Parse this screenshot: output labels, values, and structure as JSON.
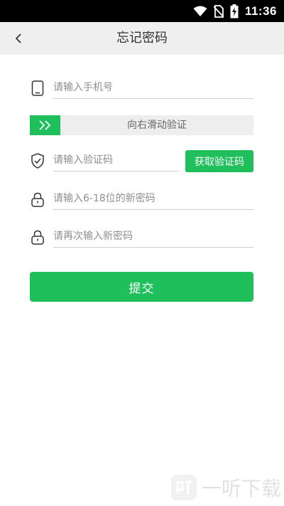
{
  "status_bar": {
    "time": "11:36",
    "icons": [
      "wifi-icon",
      "no-sim-icon",
      "battery-charging-icon"
    ]
  },
  "header": {
    "title": "忘记密码",
    "back_icon": "chevron-left-icon"
  },
  "form": {
    "phone": {
      "placeholder": "请输入手机号",
      "icon": "phone-icon"
    },
    "slider": {
      "label": "向右滑动验证",
      "handle_icon": "double-chevron-right-icon"
    },
    "code": {
      "placeholder": "请输入验证码",
      "icon": "shield-check-icon",
      "button_label": "获取验证码"
    },
    "new_password": {
      "placeholder": "请输入6-18位的新密码",
      "icon": "lock-icon"
    },
    "confirm_password": {
      "placeholder": "请再次输入新密码",
      "icon": "lock-icon"
    },
    "submit_label": "提交"
  },
  "watermark": {
    "text": "一听下载"
  },
  "colors": {
    "accent": "#1fbf5c",
    "nav_bg": "#efefef",
    "status_bg": "#000000"
  }
}
